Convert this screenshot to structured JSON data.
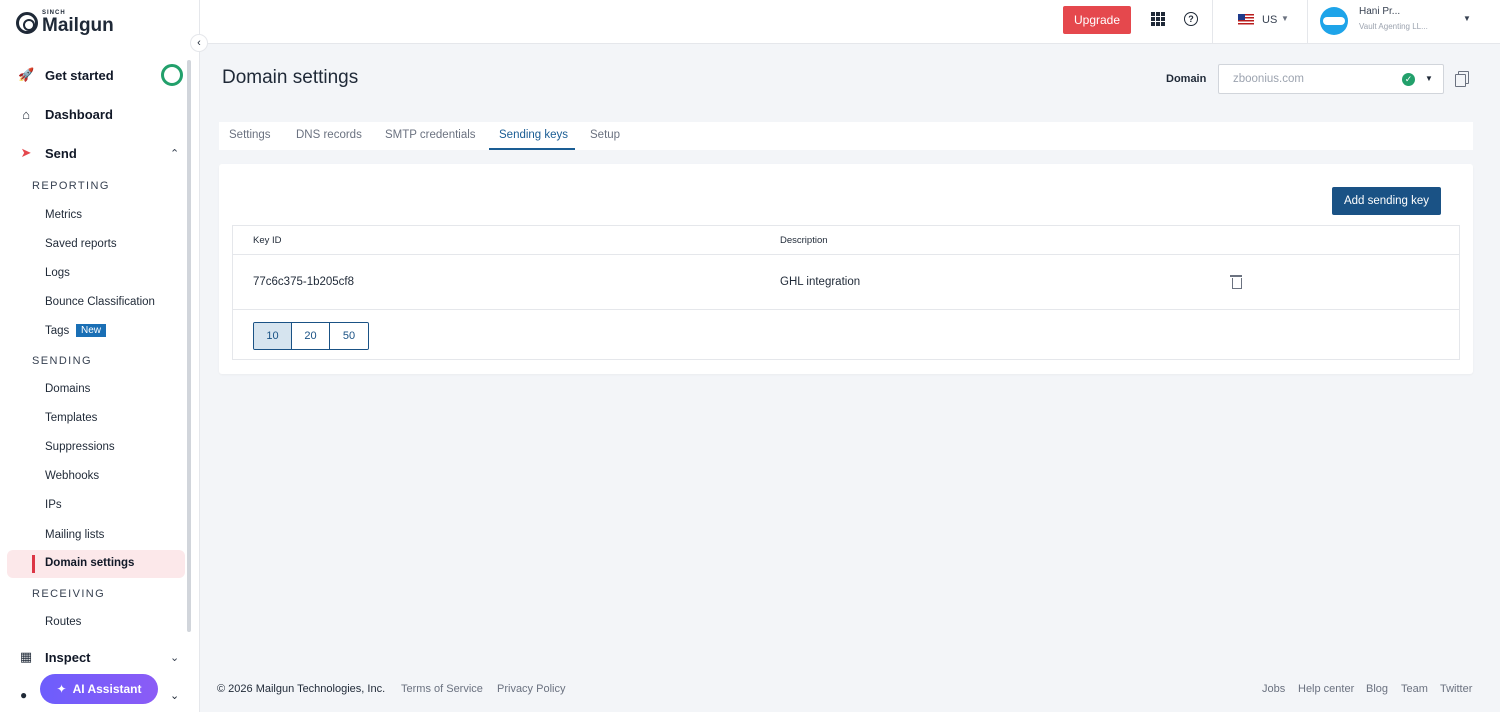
{
  "brand": {
    "sinch": "SINCH",
    "name": "Mailgun"
  },
  "sidebar": {
    "get_started": "Get started",
    "dashboard": "Dashboard",
    "send": "Send",
    "reporting_header": "REPORTING",
    "reporting_items": [
      "Metrics",
      "Saved reports",
      "Logs",
      "Bounce Classification",
      "Tags"
    ],
    "tags_badge": "New",
    "sending_header": "SENDING",
    "sending_items": [
      "Domains",
      "Templates",
      "Suppressions",
      "Webhooks",
      "IPs",
      "Mailing lists",
      "Domain settings"
    ],
    "receiving_header": "RECEIVING",
    "receiving_items": [
      "Routes"
    ],
    "inspect": "Inspect",
    "ai_assistant": "AI Assistant"
  },
  "topbar": {
    "upgrade": "Upgrade",
    "region": "US",
    "user_name": "Hani Pr...",
    "user_org": "Vault Agenting LL..."
  },
  "page": {
    "title": "Domain settings",
    "domain_label": "Domain",
    "domain_value": "zboonius.com"
  },
  "tabs": [
    "Settings",
    "DNS records",
    "SMTP credentials",
    "Sending keys",
    "Setup"
  ],
  "active_tab": "Sending keys",
  "sending_keys": {
    "add_button": "Add sending key",
    "columns": [
      "Key ID",
      "Description"
    ],
    "rows": [
      {
        "key_id": "77c6c375-1b205cf8",
        "description": "GHL integration"
      }
    ],
    "page_sizes": [
      "10",
      "20",
      "50"
    ],
    "selected_page_size": "10"
  },
  "footer": {
    "copyright": "© 2026 Mailgun Technologies, Inc.",
    "terms": "Terms of Service",
    "privacy": "Privacy Policy",
    "jobs": "Jobs",
    "help_center": "Help center",
    "blog": "Blog",
    "team": "Team",
    "twitter": "Twitter"
  },
  "colors": {
    "accent": "#1a5285",
    "upgrade": "#e5484d",
    "active_nav_bg": "#fce8ea",
    "active_nav_bar": "#dc3545",
    "success": "#22a06b",
    "ai_gradient_start": "#6d5dfc",
    "ai_gradient_end": "#8b5cf6"
  },
  "icons": [
    "rocket-icon",
    "home-icon",
    "send-icon",
    "grid-apps-icon",
    "help-icon",
    "us-flag-icon",
    "check-circle-icon",
    "copy-icon",
    "trash-icon",
    "sparkle-icon",
    "globe-icon",
    "chevron-icon"
  ]
}
